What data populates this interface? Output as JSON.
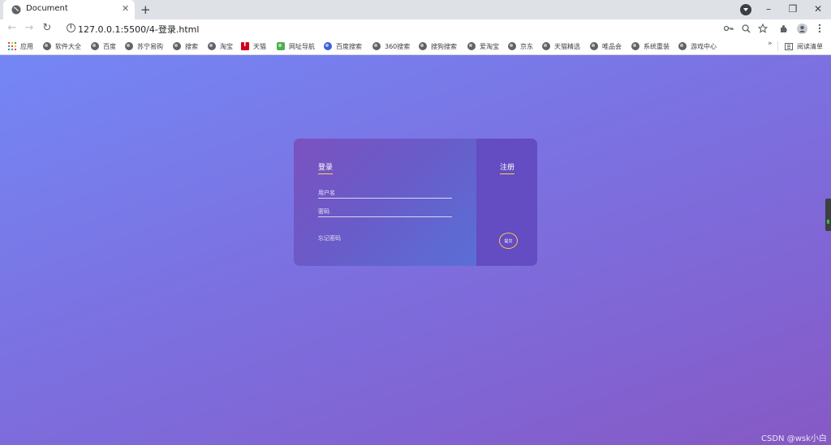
{
  "browser": {
    "tab": {
      "title": "Document",
      "close_glyph": "✕"
    },
    "new_tab_glyph": "+",
    "window_controls": {
      "minimize": "–",
      "restore": "❐",
      "close": "✕"
    },
    "nav": {
      "back": "←",
      "forward": "→",
      "reload": "↻"
    },
    "address": {
      "url": "127.0.0.1:5500/4-登录.html"
    },
    "toolbar_icons": [
      "key-icon",
      "zoom-icon",
      "star-icon",
      "extensions-icon",
      "profile-icon",
      "menu-icon"
    ],
    "bookmarks": [
      {
        "label": "应用",
        "icon": "apps-icon"
      },
      {
        "label": "软件大全",
        "icon": "globe-icon"
      },
      {
        "label": "百度",
        "icon": "globe-icon"
      },
      {
        "label": "苏宁易购",
        "icon": "globe-icon"
      },
      {
        "label": "搜索",
        "icon": "globe-icon"
      },
      {
        "label": "淘宝",
        "icon": "globe-icon"
      },
      {
        "label": "天猫",
        "icon": "tmall-icon"
      },
      {
        "label": "网址导航",
        "icon": "nav-site-icon"
      },
      {
        "label": "百度搜索",
        "icon": "baidu-paw-icon"
      },
      {
        "label": "360搜索",
        "icon": "globe-icon"
      },
      {
        "label": "搜狗搜索",
        "icon": "globe-icon"
      },
      {
        "label": "爱淘宝",
        "icon": "globe-icon"
      },
      {
        "label": "京东",
        "icon": "globe-icon"
      },
      {
        "label": "天猫精选",
        "icon": "globe-icon"
      },
      {
        "label": "唯品会",
        "icon": "globe-icon"
      },
      {
        "label": "系统重装",
        "icon": "globe-icon"
      },
      {
        "label": "游戏中心",
        "icon": "globe-icon"
      }
    ],
    "bookmarks_overflow": "»",
    "reading_list": {
      "label": "阅读清单",
      "icon": "reading-list-icon"
    }
  },
  "page": {
    "login_title": "登录",
    "signup_title": "注册",
    "username_placeholder": "用户名",
    "password_placeholder": "密码",
    "forgot_password": "忘记密码",
    "submit_label": "提交",
    "watermark": "CSDN @wsk小白",
    "colors": {
      "accent_underline": "#f7d94c",
      "submit_border": "#f2c94c",
      "signup_pane": "#644cc3"
    }
  }
}
